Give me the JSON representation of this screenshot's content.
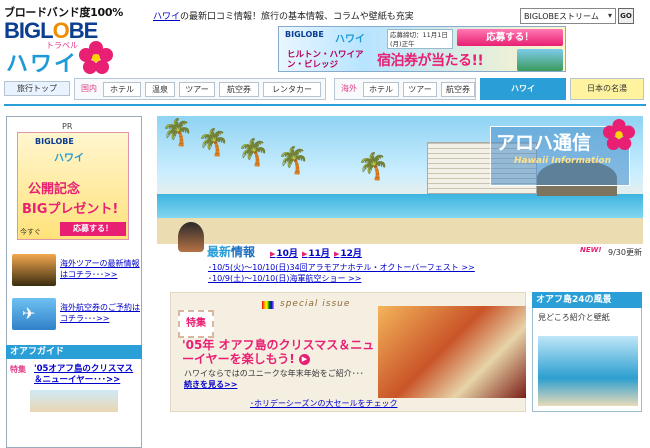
{
  "header": {
    "broadband": "ブロードバンド度100%",
    "logo_main": "BIGL",
    "logo_o": "O",
    "logo_end": "BE",
    "logo_travel": "トラベル",
    "logo_hawaii": "ハワイ",
    "tagline_link": "ハワイ",
    "tagline_rest": "の最新口コミ情報！旅行の基本情報、コラムや壁紙も充実",
    "stream_select": "BIGLOBEストリーム",
    "go_label": "GO"
  },
  "banner": {
    "biglobe": "BIGLOBE",
    "hawaii": "ハワイ",
    "date": "応募締切：11月1日(月)正午",
    "apply": "応募する！",
    "hotel": "ヒルトン・ハワイアン・ビレッジ",
    "win": "宿泊券が当たる!!"
  },
  "nav": {
    "top": "旅行トップ",
    "domestic_label": "国内",
    "domestic": [
      "ホテル",
      "温泉",
      "ツアー",
      "航空券",
      "レンタカー"
    ],
    "overseas_label": "海外",
    "overseas": [
      "ホテル",
      "ツアー",
      "航空券"
    ],
    "hawaii": "ハワイ",
    "meisho": "日本の名湯"
  },
  "left": {
    "pr": "PR",
    "pr_biglobe": "BIGLOBE",
    "pr_hawaii": "ハワイ",
    "pr_kinen": "公開記念",
    "pr_big": "BIGプレゼント!",
    "pr_imasugu": "今すぐ",
    "pr_apply": "応募する！",
    "link1": "海外ツアーの最新情報はコチラ･･･>>",
    "link2": "海外航空券のご予約はコチラ･･･>>",
    "guide_title": "オアフガイド",
    "guide_tag": "特集",
    "guide_link": "'05オアフ島のクリスマス＆ニューイヤー･･･>>"
  },
  "hero": {
    "aloha_title": "アロハ通信",
    "aloha_sub": "Hawaii Information"
  },
  "news": {
    "title_a": "最新",
    "title_b": "情報",
    "months": [
      "10月",
      "11月",
      "12月"
    ],
    "new_label": "NEW!",
    "updated": "9/30更新",
    "items": [
      "･10/5(火)～10/10(日)34回アラモアナホテル・オクトーバーフェスト >>",
      "･10/9(土)～10/10(日)海軍航空ショー >>"
    ]
  },
  "special": {
    "label": "special issue",
    "stamp": "特集",
    "title": "'05年 オアフ島のクリスマス＆ニューイヤーを楽しもう!",
    "body": "ハワイならではのユニークな年末年始をご紹介･･･",
    "more": "続きを見る>>",
    "sale": "･ホリデーシーズンの大セールをチェック"
  },
  "right": {
    "head": "オアフ島24の風景",
    "sub": "見どころ紹介と壁紙"
  },
  "colors": {
    "accent_blue": "#2a9ed6",
    "accent_pink": "#e81f72",
    "link": "#0000cc"
  }
}
